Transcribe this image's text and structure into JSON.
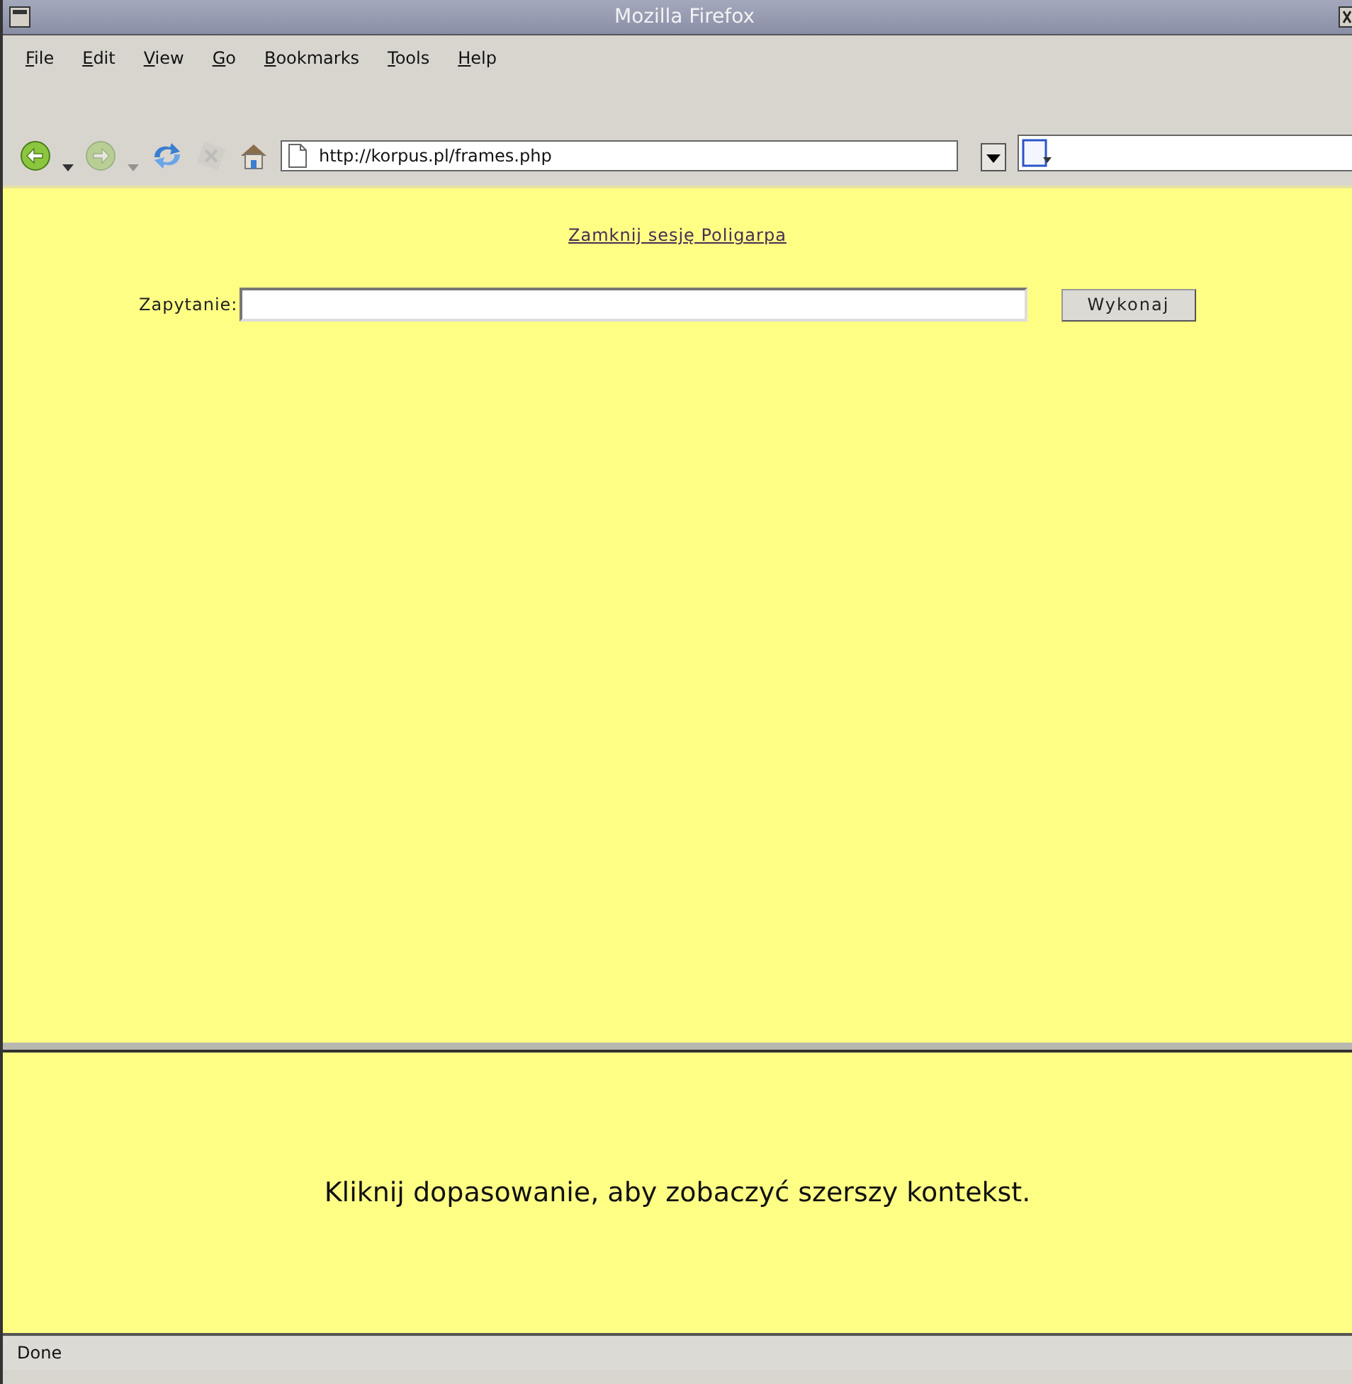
{
  "window": {
    "title": "Mozilla Firefox"
  },
  "menu": [
    "File",
    "Edit",
    "View",
    "Go",
    "Bookmarks",
    "Tools",
    "Help"
  ],
  "navigation": {
    "back_enabled": true,
    "forward_enabled": false,
    "url": "http://korpus.pl/frames.php"
  },
  "top_frame": {
    "link": "Zamknij sesję Poligarpa",
    "query_label": "Zapytanie:",
    "submit": "Wykonaj"
  },
  "bottom_frame": {
    "message": "Kliknij dopasowanie, aby zobaczyć szerszy kontekst."
  },
  "status_bar": {
    "text": "Done"
  }
}
